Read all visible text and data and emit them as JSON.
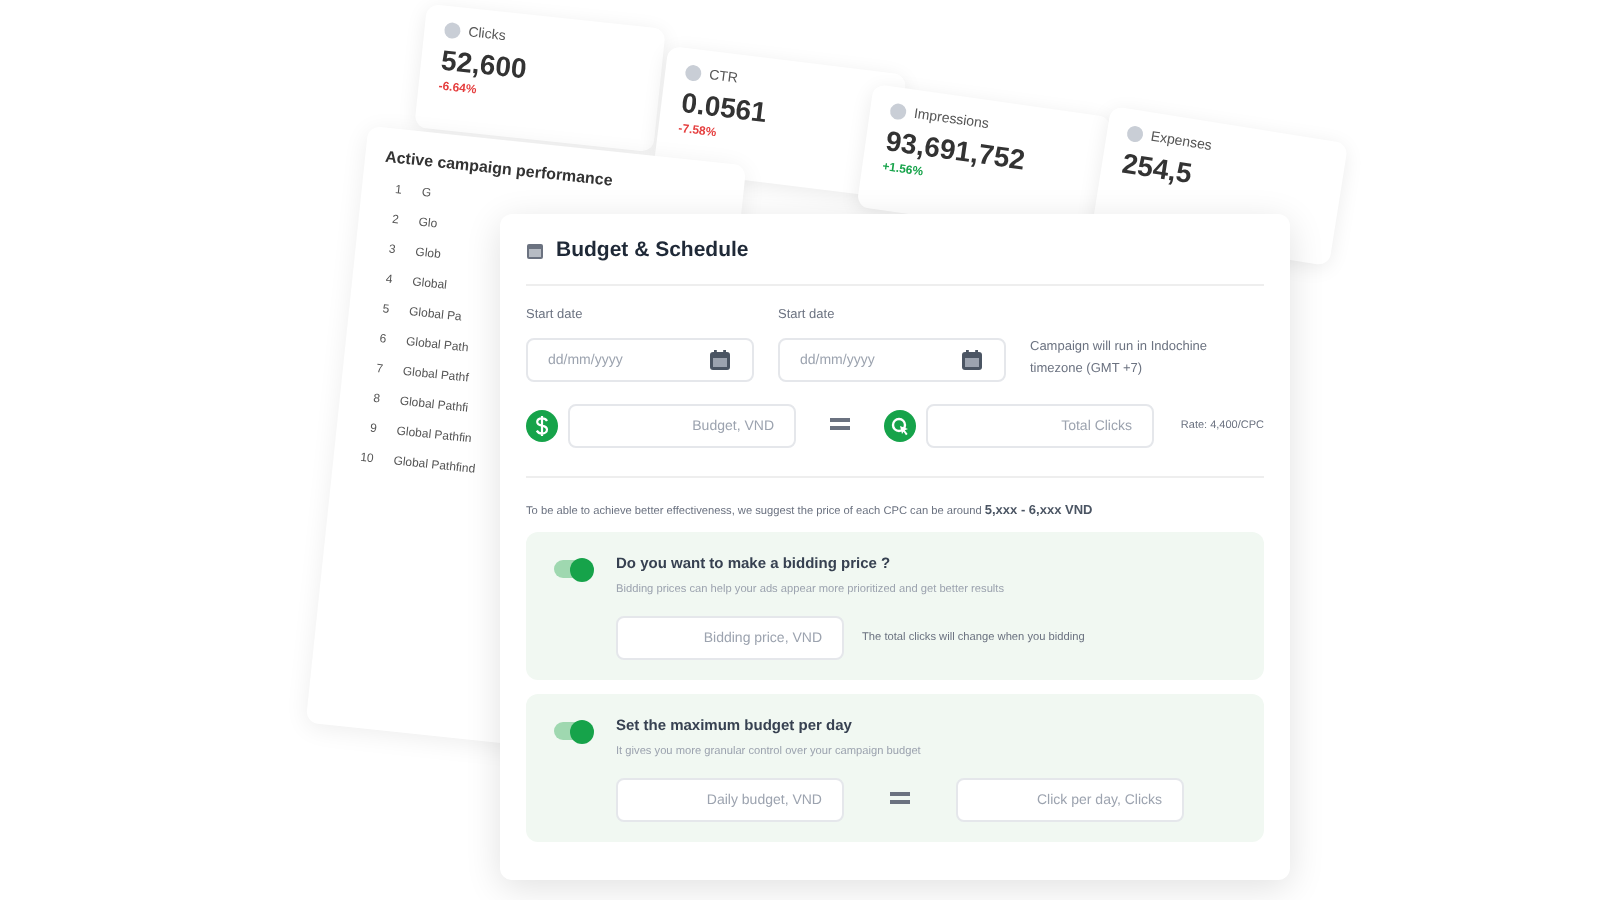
{
  "stats": [
    {
      "label": "Clicks",
      "value": "52,600",
      "change": "-6.64%",
      "color": "#e53e3e"
    },
    {
      "label": "CTR",
      "value": "0.0561",
      "change": "-7.58%",
      "color": "#e53e3e"
    },
    {
      "label": "Impressions",
      "value": "93,691,752",
      "change": "+1.56%",
      "color": "#16a34a"
    },
    {
      "label": "Expenses",
      "value": "254,5"
    }
  ],
  "performance": {
    "title": "Active campaign performance",
    "rows": [
      {
        "index": "1",
        "name": "G"
      },
      {
        "index": "2",
        "name": "Glo"
      },
      {
        "index": "3",
        "name": "Glob"
      },
      {
        "index": "4",
        "name": "Global"
      },
      {
        "index": "5",
        "name": "Global Pa"
      },
      {
        "index": "6",
        "name": "Global Path"
      },
      {
        "index": "7",
        "name": "Global Pathf"
      },
      {
        "index": "8",
        "name": "Global Pathfi"
      },
      {
        "index": "9",
        "name": "Global Pathfin"
      },
      {
        "index": "10",
        "name": "Global Pathfind"
      }
    ]
  },
  "budget": {
    "title": "Budget & Schedule",
    "dates": [
      {
        "label": "Start date",
        "placeholder": "dd/mm/yyyy"
      },
      {
        "label": "Start date",
        "placeholder": "dd/mm/yyyy"
      }
    ],
    "timezone_note": "Campaign will run in Indochine timezone (GMT +7)",
    "budget_placeholder": "Budget, VND",
    "clicks_placeholder": "Total Clicks",
    "rate": "Rate: 4,400/CPC",
    "suggestion": "To be able to achieve better effectiveness, we suggest the price of each CPC can be around **5,xxx - 6,xxx VND**",
    "options": [
      {
        "title": "Do you want to make a bidding price ?",
        "description": "Bidding prices can help your ads appear more prioritized and get better results",
        "on": true,
        "fields": [
          {
            "placeholder": "Bidding price, VND"
          }
        ],
        "note": "The total clicks will change when you bidding"
      },
      {
        "title": "Set the maximum budget per day",
        "description": "It gives you more granular control over your campaign budget",
        "on": true,
        "fields": [
          {
            "placeholder": "Daily budget, VND"
          },
          {
            "placeholder": "Click per day, Clicks"
          }
        ]
      }
    ]
  }
}
